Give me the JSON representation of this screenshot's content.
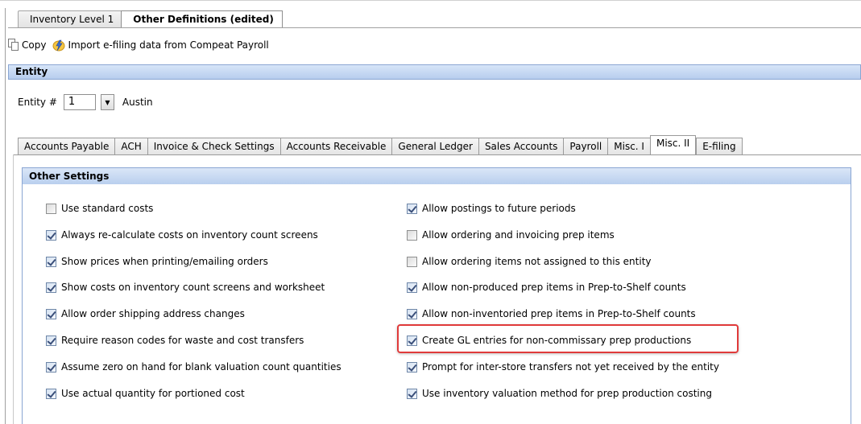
{
  "doc_tabs": [
    {
      "label": "Inventory Level 1"
    },
    {
      "label": "Other Definitions (edited)"
    }
  ],
  "toolbar": {
    "copy_label": "Copy",
    "import_label": "Import e-filing data from Compeat Payroll"
  },
  "entity": {
    "header": "Entity",
    "label": "Entity #",
    "value": "1",
    "name": "Austin"
  },
  "settings_tabs": [
    {
      "label": "Accounts Payable"
    },
    {
      "label": "ACH"
    },
    {
      "label": "Invoice & Check Settings"
    },
    {
      "label": "Accounts Receivable"
    },
    {
      "label": "General Ledger"
    },
    {
      "label": "Sales Accounts"
    },
    {
      "label": "Payroll"
    },
    {
      "label": "Misc. I"
    },
    {
      "label": "Misc. II"
    },
    {
      "label": "E-filing"
    }
  ],
  "active_settings_tab": "Misc. II",
  "other_settings": {
    "header": "Other Settings",
    "left": [
      {
        "label": "Use standard costs",
        "checked": false
      },
      {
        "label": "Always re-calculate costs on inventory count screens",
        "checked": true
      },
      {
        "label": "Show prices when printing/emailing orders",
        "checked": true
      },
      {
        "label": "Show costs on inventory count screens and worksheet",
        "checked": true
      },
      {
        "label": "Allow order shipping address changes",
        "checked": true
      },
      {
        "label": "Require reason codes for waste and cost transfers",
        "checked": true
      },
      {
        "label": "Assume zero on hand for blank valuation count quantities",
        "checked": true
      },
      {
        "label": "Use actual quantity for portioned cost",
        "checked": true
      }
    ],
    "right": [
      {
        "label": "Allow postings to future periods",
        "checked": true
      },
      {
        "label": "Allow ordering and invoicing prep items",
        "checked": false
      },
      {
        "label": "Allow ordering items not assigned to this entity",
        "checked": false
      },
      {
        "label": "Allow non-produced prep items in Prep-to-Shelf counts",
        "checked": true
      },
      {
        "label": "Allow non-inventoried prep items in Prep-to-Shelf counts",
        "checked": true
      },
      {
        "label": "Create GL entries for non-commissary prep productions",
        "checked": true
      },
      {
        "label": "Prompt for inter-store transfers not yet received by the entity",
        "checked": true
      },
      {
        "label": "Use inventory valuation method for prep production costing",
        "checked": true
      }
    ]
  },
  "colors": {
    "header_gradient_top": "#d7e5f8",
    "header_gradient_bottom": "#b7cdee",
    "highlight_border": "#e03a3a"
  }
}
